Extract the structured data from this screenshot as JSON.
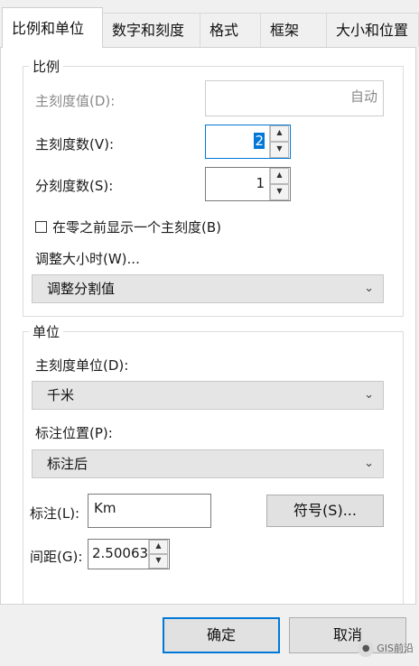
{
  "tabs": [
    {
      "label": "比例和单位",
      "active": true
    },
    {
      "label": "数字和刻度",
      "active": false
    },
    {
      "label": "格式",
      "active": false
    },
    {
      "label": "框架",
      "active": false
    },
    {
      "label": "大小和位置",
      "active": false
    }
  ],
  "scale_group": {
    "title": "比例",
    "major_tick_value_label": "主刻度值(D):",
    "major_tick_value": "自动",
    "major_tick_count_label": "主刻度数(V):",
    "major_tick_count": "2",
    "minor_tick_count_label": "分刻度数(S):",
    "minor_tick_count": "1",
    "checkbox_label": "在零之前显示一个主刻度(B)",
    "checkbox_checked": false,
    "resize_label": "调整大小时(W)...",
    "resize_value": "调整分割值"
  },
  "units_group": {
    "title": "单位",
    "division_units_label": "主刻度单位(D):",
    "division_units_value": "千米",
    "label_position_label": "标注位置(P):",
    "label_position_value": "标注后",
    "label_label": "标注(L):",
    "label_value": "Km",
    "symbol_button": "符号(S)...",
    "gap_label": "间距(G):",
    "gap_value": "2.50063"
  },
  "footer": {
    "ok_button": "确定",
    "cancel_button": "取消"
  },
  "watermark": {
    "text": "GIS前沿",
    "icon": "wechat-icon"
  },
  "colors": {
    "accent": "#0078d7",
    "panel_bg": "#ffffff",
    "dialog_bg": "#f0f0f0"
  }
}
